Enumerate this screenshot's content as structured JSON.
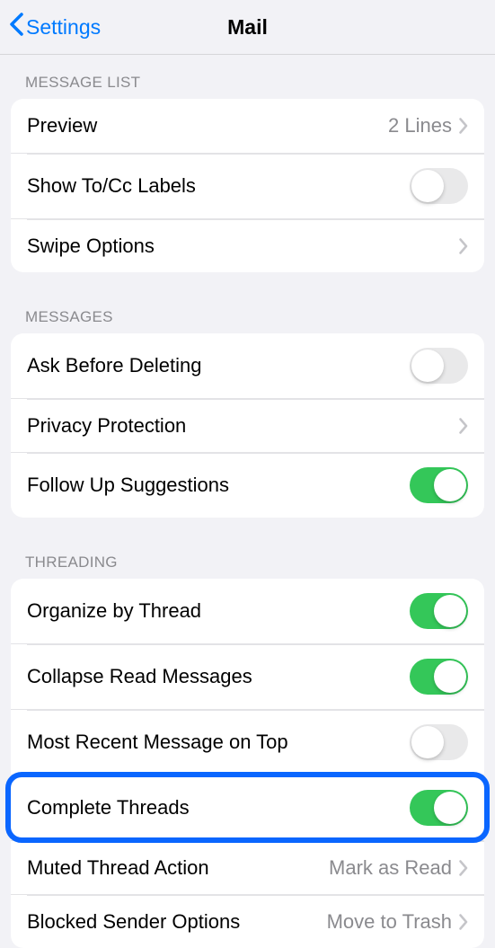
{
  "nav": {
    "back_label": "Settings",
    "title": "Mail"
  },
  "sections": {
    "message_list": {
      "header": "Message List",
      "rows": {
        "preview": {
          "label": "Preview",
          "detail": "2 Lines"
        },
        "show_tocc": {
          "label": "Show To/Cc Labels",
          "toggle": false
        },
        "swipe": {
          "label": "Swipe Options"
        }
      }
    },
    "messages": {
      "header": "Messages",
      "rows": {
        "ask_delete": {
          "label": "Ask Before Deleting",
          "toggle": false
        },
        "privacy": {
          "label": "Privacy Protection"
        },
        "follow_up": {
          "label": "Follow Up Suggestions",
          "toggle": true
        }
      }
    },
    "threading": {
      "header": "Threading",
      "rows": {
        "organize": {
          "label": "Organize by Thread",
          "toggle": true
        },
        "collapse": {
          "label": "Collapse Read Messages",
          "toggle": true
        },
        "recent_top": {
          "label": "Most Recent Message on Top",
          "toggle": false
        },
        "complete": {
          "label": "Complete Threads",
          "toggle": true
        },
        "muted": {
          "label": "Muted Thread Action",
          "detail": "Mark as Read"
        },
        "blocked": {
          "label": "Blocked Sender Options",
          "detail": "Move to Trash"
        }
      }
    }
  },
  "highlight": {
    "row": "complete"
  }
}
